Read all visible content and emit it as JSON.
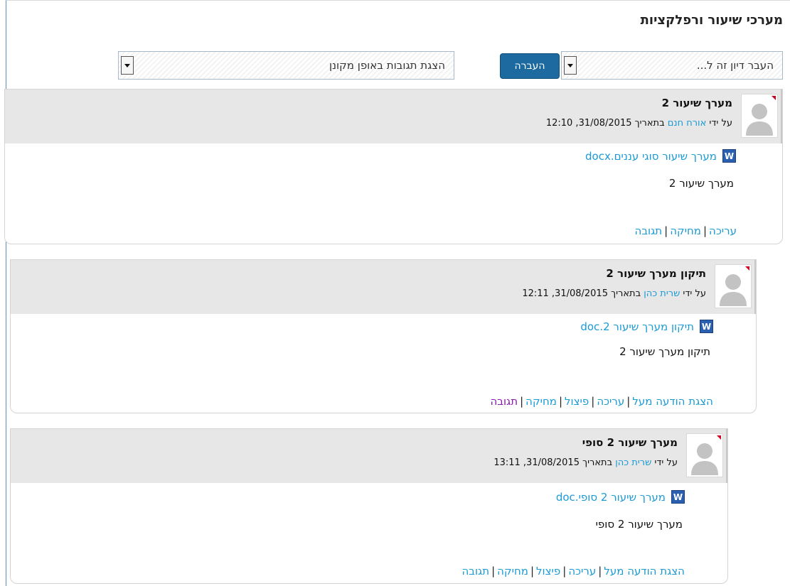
{
  "page": {
    "title": "מערכי שיעור ורפלקציות"
  },
  "controls": {
    "move_select_value": "העבר דיון זה ל...",
    "move_button": "העברה",
    "display_select_value": "הצגת תגובות באופן מקונן"
  },
  "posts": [
    {
      "subject": "מערך שיעור 2",
      "by_label": "על ידי",
      "author": "אורח חנם",
      "date_text": "בתאריך 31/08/2015, 12:10",
      "attachment": "מערך שיעור סוגי עננים.docx",
      "body": "מערך שיעור 2",
      "commands": [
        "עריכה",
        "מחיקה",
        "תגובה"
      ]
    },
    {
      "subject": "תיקון מערך שיעור 2",
      "by_label": "על ידי",
      "author": "שרית כהן",
      "date_text": "בתאריך 31/08/2015, 12:11",
      "attachment": "תיקון מערך שיעור 2.doc",
      "body": "תיקון מערך שיעור 2",
      "commands": [
        "הצגת הודעה מעל",
        "עריכה",
        "פיצול",
        "מחיקה",
        "תגובה"
      ]
    },
    {
      "subject": "מערך שיעור 2 סופי",
      "by_label": "על ידי",
      "author": "שרית כהן",
      "date_text": "בתאריך 31/08/2015, 13:11",
      "attachment": "מערך שיעור 2 סופי.doc",
      "body": "מערך שיעור 2 סופי",
      "commands": [
        "הצגת הודעה מעל",
        "עריכה",
        "פיצול",
        "מחיקה",
        "תגובה"
      ]
    }
  ],
  "colors": {
    "link": "#1a9ad6",
    "visited_link": "#8b1ab0",
    "button_bg": "#1c6aa0",
    "header_bg": "#e7e7e7"
  },
  "icons": {
    "attachment": "word-document-icon",
    "avatar": "user-avatar-icon",
    "dropdown": "chevron-down-icon"
  }
}
